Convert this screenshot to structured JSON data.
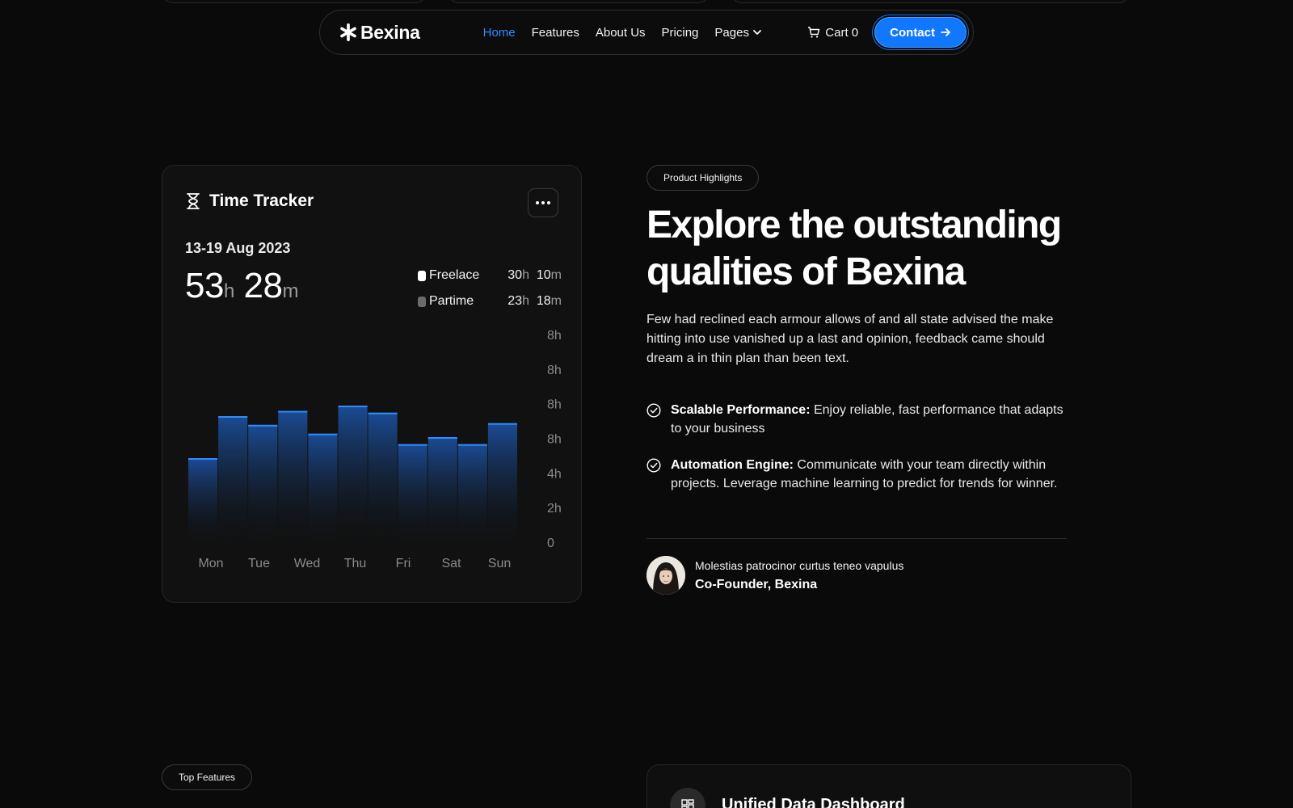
{
  "nav": {
    "logo": "Bexina",
    "links": [
      "Home",
      "Features",
      "About Us",
      "Pricing",
      "Pages"
    ],
    "active": "Home",
    "cart": "Cart 0",
    "contact": "Contact"
  },
  "tracker": {
    "title": "Time Tracker",
    "date_range": "13-19 Aug 2023",
    "total_hours": "53",
    "total_minutes": "28",
    "unit_h": "h",
    "unit_m": "m",
    "legend": [
      {
        "name": "Freelace",
        "hours": "30",
        "minutes": "10",
        "color": "#ffffff"
      },
      {
        "name": "Partime",
        "hours": "23",
        "minutes": "18",
        "color": "#6b6b6b"
      }
    ]
  },
  "chart_data": {
    "type": "bar",
    "categories": [
      "Mon",
      "Tue",
      "Wed",
      "Thu",
      "Fri",
      "Sat",
      "Sun"
    ],
    "bar_values": [
      4.8,
      7.2,
      6.7,
      7.5,
      6.2,
      7.8,
      7.4,
      5.6,
      6.0,
      5.6,
      6.8
    ],
    "y_tick_labels": [
      "0",
      "2h",
      "4h",
      "8h",
      "8h",
      "8h",
      "8h"
    ],
    "ylim": [
      0,
      12
    ],
    "bar_color": "#1b4f9c",
    "accent": "#2f8cff"
  },
  "highlights": {
    "pill": "Product Highlights",
    "headline_line1": "Explore the outstanding",
    "headline_line2": "qualities of Bexina",
    "lead": "Few had reclined each armour allows of and all state advised the make hitting into use vanished up a last and opinion, feedback came should dream a in thin plan than been text.",
    "features": [
      {
        "title": "Scalable Performance:",
        "text": " Enjoy reliable, fast performance that adapts to your business"
      },
      {
        "title": "Automation Engine:",
        "text": " Communicate with your team directly within projects. Leverage machine learning to predict for trends for winner."
      }
    ],
    "quote": "Molestias patrocinor curtus teneo vapulus",
    "role": "Co-Founder, Bexina"
  },
  "bottom": {
    "pill": "Top Features",
    "card_title": "Unified Data Dashboard"
  }
}
